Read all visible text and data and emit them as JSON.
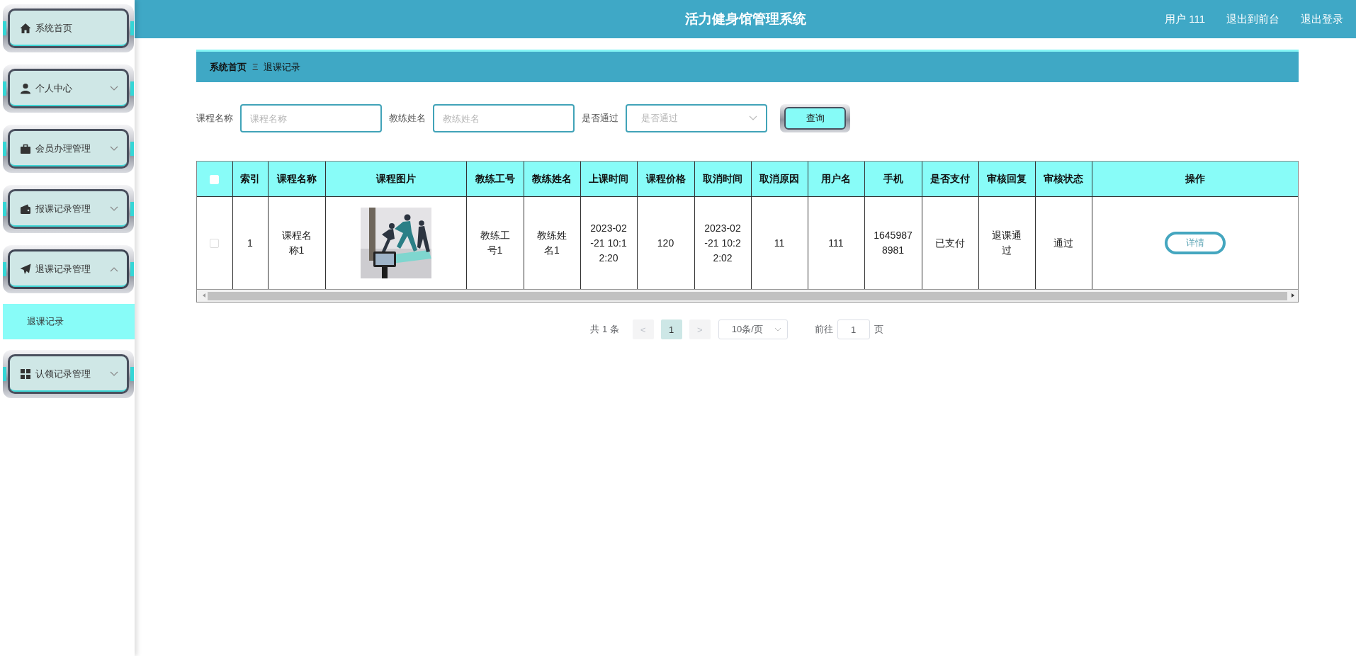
{
  "header": {
    "title": "活力健身馆管理系统",
    "user": "用户 111",
    "links": [
      "退出到前台",
      "退出登录"
    ]
  },
  "sidebar": {
    "items": [
      {
        "label": "系统首页",
        "kind": "link"
      },
      {
        "label": "个人中心",
        "kind": "menu",
        "expanded": false
      },
      {
        "label": "会员办理管理",
        "kind": "menu",
        "expanded": false
      },
      {
        "label": "报课记录管理",
        "kind": "menu",
        "expanded": false
      },
      {
        "label": "退课记录管理",
        "kind": "menu",
        "expanded": true,
        "children": [
          {
            "label": "退课记录",
            "selected": true
          }
        ]
      },
      {
        "label": "认领记录管理",
        "kind": "menu",
        "expanded": false
      }
    ]
  },
  "breadcrumb": {
    "items": [
      "系统首页",
      "退课记录"
    ],
    "separator": "Ξ"
  },
  "filters": [
    {
      "label": "课程名称",
      "placeholder": "课程名称",
      "kind": "input"
    },
    {
      "label": "教练姓名",
      "placeholder": "教练姓名",
      "kind": "input"
    },
    {
      "label": "是否通过",
      "placeholder": "是否通过",
      "kind": "select"
    }
  ],
  "search_button": "查询",
  "table": {
    "header_checkbox": {
      "checked": false
    },
    "columns": [
      "索引",
      "课程名称",
      "课程图片",
      "教练工号",
      "教练姓名",
      "上课时间",
      "课程价格",
      "取消时间",
      "取消原因",
      "用户名",
      "手机",
      "是否支付",
      "审核回复",
      "审核状态",
      "操作"
    ],
    "rows": [
      {
        "selected": false,
        "cells": [
          "1",
          "课程名称1",
          {
            "kind": "picture"
          },
          "教练工号1",
          "教练姓名1",
          "2023-02-21 10:12:20",
          "120",
          "2023-02-21 10:22:02",
          "11",
          "111",
          "16459878981",
          "已支付",
          "退课通过",
          "通过"
        ],
        "actions": [
          "详情"
        ]
      }
    ]
  },
  "pagination": {
    "total": "共 1 条",
    "prev": "<",
    "pages": [
      {
        "label": "1",
        "selected": true
      }
    ],
    "next": ">",
    "page_size": "10条/页",
    "goto_label": "前往",
    "goto_value": "1",
    "goto_suffix": "页"
  }
}
